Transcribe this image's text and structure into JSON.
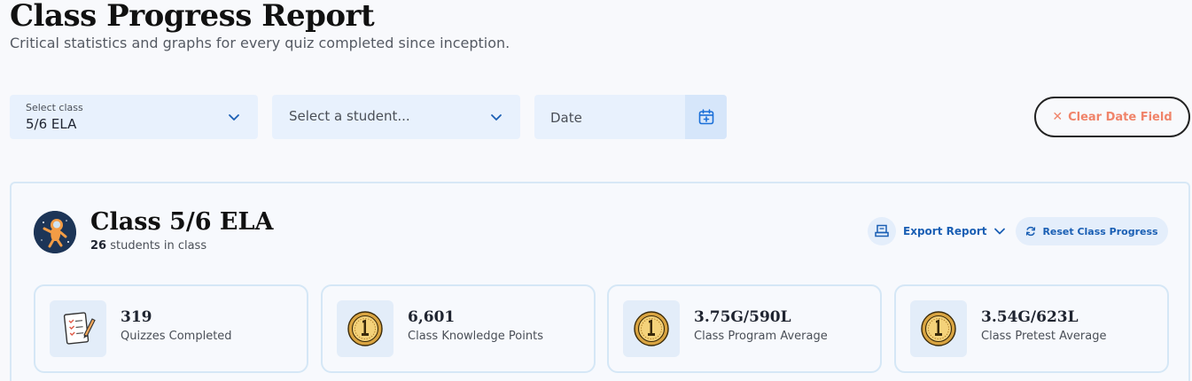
{
  "header": {
    "title": "Class Progress Report",
    "subtitle": "Critical statistics and graphs for every quiz completed since inception."
  },
  "filters": {
    "class_label": "Select class",
    "class_value": "5/6 ELA",
    "student_placeholder": "Select a student...",
    "date_placeholder": "Date",
    "clear_label": "Clear Date Field"
  },
  "class_card": {
    "title": "Class 5/6 ELA",
    "student_count": "26",
    "student_suffix": "students in class",
    "export_label": "Export Report",
    "reset_label": "Reset Class Progress"
  },
  "stats": [
    {
      "value": "319",
      "label": "Quizzes Completed",
      "icon": "quiz-checklist-icon"
    },
    {
      "value": "6,601",
      "label": "Class Knowledge Points",
      "icon": "gold-coin-icon"
    },
    {
      "value": "3.75G/590L",
      "label": "Class Program Average",
      "icon": "gold-coin-icon"
    },
    {
      "value": "3.54G/623L",
      "label": "Class Pretest Average",
      "icon": "gold-coin-icon"
    }
  ],
  "colors": {
    "accent_blue": "#1a5fb4",
    "clear_orange": "#f0846a",
    "field_bg": "#e8f1fd"
  }
}
